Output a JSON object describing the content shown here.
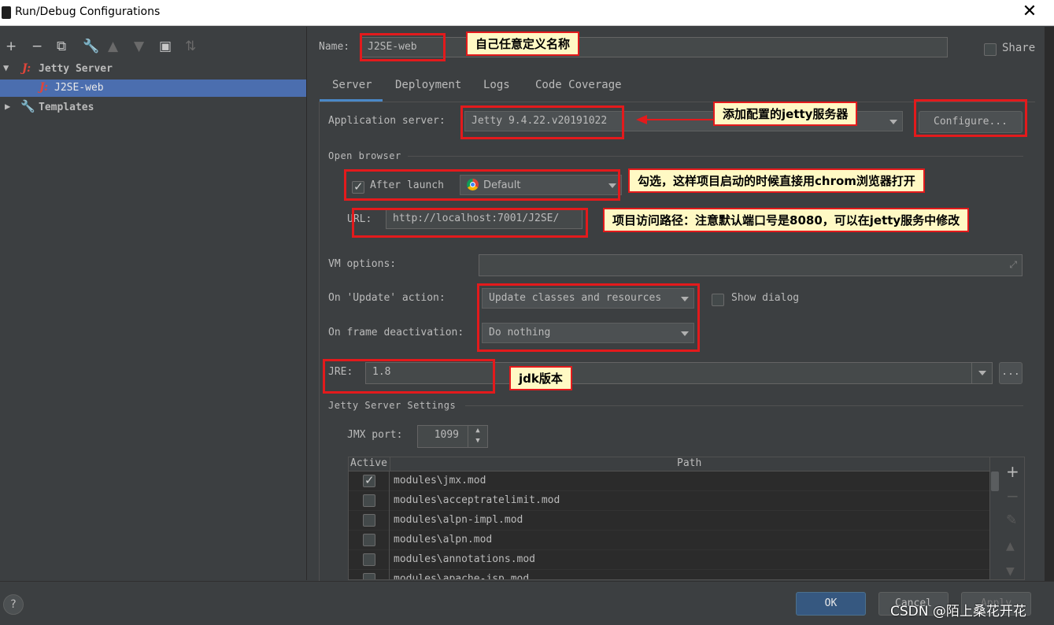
{
  "window": {
    "title": "Run/Debug Configurations"
  },
  "tree": {
    "items": [
      {
        "label": "Jetty Server",
        "expanded": true
      },
      {
        "label": "J2SE-web",
        "selected": true
      },
      {
        "label": "Templates",
        "expanded": false
      }
    ]
  },
  "name": {
    "label": "Name:",
    "value": "J2SE-web"
  },
  "share": {
    "label": "Share",
    "checked": false
  },
  "tabs": [
    "Server",
    "Deployment",
    "Logs",
    "Code Coverage"
  ],
  "active_tab": "Server",
  "server": {
    "app_server_label": "Application server:",
    "app_server_value": "Jetty 9.4.22.v20191022",
    "configure_label": "Configure...",
    "open_browser_label": "Open browser",
    "after_launch_label": "After launch",
    "after_launch_checked": true,
    "browser_value": "Default",
    "url_label": "URL:",
    "url_value": "http://localhost:7001/J2SE/",
    "vm_options_label": "VM options:",
    "vm_options_value": "",
    "update_action_label": "On 'Update' action:",
    "update_action_value": "Update classes and resources",
    "show_dialog_label": "Show dialog",
    "frame_deactivation_label": "On frame deactivation:",
    "frame_deactivation_value": "Do nothing",
    "jre_label": "JRE:",
    "jre_value": "1.8",
    "jre_more": "...",
    "settings_label": "Jetty Server Settings",
    "jmx_label": "JMX port:",
    "jmx_value": "1099"
  },
  "modules_table": {
    "headers": [
      "Active",
      "Path"
    ],
    "rows": [
      {
        "active": true,
        "path": "modules\\jmx.mod"
      },
      {
        "active": false,
        "path": "modules\\acceptratelimit.mod"
      },
      {
        "active": false,
        "path": "modules\\alpn-impl.mod"
      },
      {
        "active": false,
        "path": "modules\\alpn.mod"
      },
      {
        "active": false,
        "path": "modules\\annotations.mod"
      },
      {
        "active": false,
        "path": "modules\\apache-jsp.mod"
      }
    ]
  },
  "annotations": {
    "name_note": "自己任意定义名称",
    "server_note": "添加配置的jetty服务器",
    "browser_note": "勾选，这样项目启动的时候直接用chrom浏览器打开",
    "url_note": "项目访问路径：注意默认端口号是8080，可以在jetty服务中修改",
    "jre_note": "jdk版本"
  },
  "footer": {
    "help": "?",
    "ok_label": "OK",
    "cancel_label": "Cancel",
    "apply_label": "Apply",
    "watermark": "CSDN @陌上桑花开花"
  },
  "colors": {
    "accent": "#4b6eaf",
    "annotation_border": "#e31a1c",
    "note_bg": "#fff9c4",
    "ok_button": "#365880"
  }
}
